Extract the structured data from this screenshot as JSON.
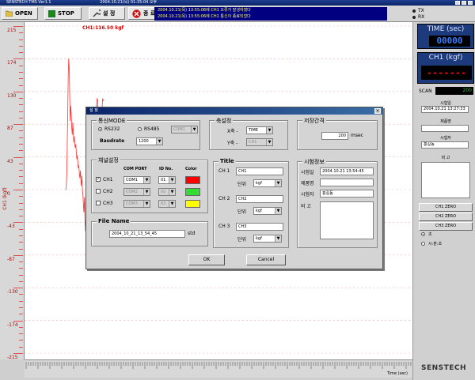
{
  "app": {
    "title": "SENSTECH TMS Ver1.1",
    "datetime": "2004.10.21(목) 01:35:04 오후"
  },
  "toolbar": {
    "open": "OPEN",
    "stop": "STOP",
    "setup": "설 정",
    "exit": "종 료"
  },
  "messages": [
    "2004.10.21(목) 13:55:06에 CH1 오류가 발생하였다",
    "2004.10.21(목) 13:55:06에 CH1 통신이 종료되었다"
  ],
  "status": {
    "tx": "TX",
    "rx": "RX"
  },
  "chart_data": {
    "type": "line",
    "series": [
      {
        "name": "CH1",
        "current_label": "CH1:116.50 kgf"
      }
    ],
    "yticks": [
      "215",
      "174",
      "130",
      "87",
      "43",
      "0",
      "-43",
      "-87",
      "-130",
      "-174",
      "-215"
    ],
    "ylabel": "CH1 (kgf)",
    "xlabel": "Time (sec)",
    "trace_y": [
      0,
      0,
      20,
      55,
      105,
      150,
      172,
      160,
      120,
      90,
      110,
      98,
      80,
      72,
      88,
      75,
      62,
      70,
      58,
      55,
      60,
      48,
      40,
      45,
      35,
      28,
      32,
      20,
      15,
      25,
      12,
      5,
      18,
      0,
      -8,
      -20,
      -30,
      -10,
      -40,
      -55,
      -35,
      -60,
      -75,
      -50,
      -70,
      -85,
      -58,
      -62,
      -45,
      -30,
      -48,
      -20,
      -32,
      -10,
      -18,
      -8,
      10,
      30,
      55,
      80,
      100,
      113,
      120,
      118,
      100,
      95,
      90,
      80,
      85,
      70,
      62,
      90,
      110,
      120,
      117,
      116.5
    ]
  },
  "right": {
    "time_title": "TIME (sec)",
    "time_value": "00000",
    "ch1_title": "CH1 (kgf)",
    "ch1_value": "-------",
    "scan_label": "SCAN",
    "scan_value": "200",
    "test_date_label": "시험일",
    "test_date": "2004.10.21 13:27:33",
    "product_label": "제품명",
    "product": "",
    "tester_label": "시험자",
    "tester": "홍길동",
    "note_label": "비 고",
    "note": "",
    "ch1_zero": "CH1 ZERO",
    "ch2_zero": "CH2 ZERO",
    "ch3_zero": "CH3 ZERO",
    "opt1": "초",
    "opt2": "시:분:초"
  },
  "dialog": {
    "title": "설 정",
    "comm_group": "통신MODE",
    "rs232": "RS232",
    "rs485": "RS485",
    "rs485_port": "COM1",
    "baud_label": "Baudrate",
    "baud": "1200",
    "axis_group": "축설정",
    "x_label": "X축 -",
    "x_value": "TIME",
    "y_label": "Y축 -",
    "y_value": "CH1",
    "interval_group": "저장간격",
    "interval_value": "200",
    "interval_unit": "msec",
    "ch_group": "채널설정",
    "col_port": "COM PORT",
    "col_id": "ID No.",
    "col_color": "Color",
    "channels": [
      {
        "name": "CH1",
        "port": "COM1",
        "id": "01",
        "color": "#ff0000",
        "checked": "✓"
      },
      {
        "name": "CH2",
        "port": "COM2",
        "id": "02",
        "color": "#33dd33",
        "checked": ""
      },
      {
        "name": "CH3",
        "port": "COM3",
        "id": "03",
        "color": "#ffff00",
        "checked": ""
      }
    ],
    "title_group": "Title",
    "titles": [
      {
        "label": "CH 1",
        "value": "CH1",
        "unit_label": "단위",
        "unit": "kgf"
      },
      {
        "label": "CH 2",
        "value": "CH2",
        "unit_label": "단위",
        "unit": "kgf"
      },
      {
        "label": "CH 3",
        "value": "CH3",
        "unit_label": "단위",
        "unit": "kgf"
      }
    ],
    "file_group": "File Name",
    "file_value": "2004_10_21_13_54_45",
    "file_ext": "std",
    "info_group": "시험정보",
    "info_date_label": "시험일",
    "info_date": "2004.10.21 13:54:45",
    "info_product_label": "제품명",
    "info_product": "",
    "info_tester_label": "시험자",
    "info_tester": "홍길동",
    "info_note_label": "비 고",
    "info_note": "",
    "ok": "OK",
    "cancel": "Cancel"
  },
  "brand": "SENSTECH"
}
